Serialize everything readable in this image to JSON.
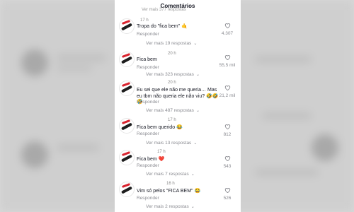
{
  "header": {
    "title": "Comentários"
  },
  "top_faded": {
    "text": "Ver mais 377 respostas"
  },
  "comments": [
    {
      "time": "17 h",
      "text": "Tropa do \"fica bem\" 🤙",
      "reply_label": "Responder",
      "likes": "4.307",
      "more": "Ver mais 19 respostas"
    },
    {
      "time": "20 h",
      "text": "Fica bem",
      "reply_label": "Responder",
      "likes": "55,5 mil",
      "more": "Ver mais 323 respostas"
    },
    {
      "time": "20 h",
      "text": "Eu sei que ele não me queria… Mas eu tbm não queria ele não viu? 🤣🤣🤣",
      "reply_label": "Responder",
      "likes": "21,2 mil",
      "more": "Ver mais 487 respostas"
    },
    {
      "time": "17 h",
      "text": "Fica bem querido 😂",
      "reply_label": "Responder",
      "likes": "812",
      "more": "Ver mais 13 respostas"
    },
    {
      "time": "17 h",
      "text": "Fica bem ❤️",
      "reply_label": "Responder",
      "likes": "543",
      "more": "Ver mais 7 respostas"
    },
    {
      "time": "16 h",
      "text": "Vim só pelos \"FICA BEM\" 😂",
      "reply_label": "Responder",
      "likes": "526",
      "more": "Ver mais 2 respostas"
    }
  ],
  "icons": {
    "like": "heart-outline-icon",
    "expand": "chevron-down-icon"
  },
  "colors": {
    "panel_bg": "#ffffff",
    "text": "#161823",
    "muted": "#8a8b91"
  }
}
